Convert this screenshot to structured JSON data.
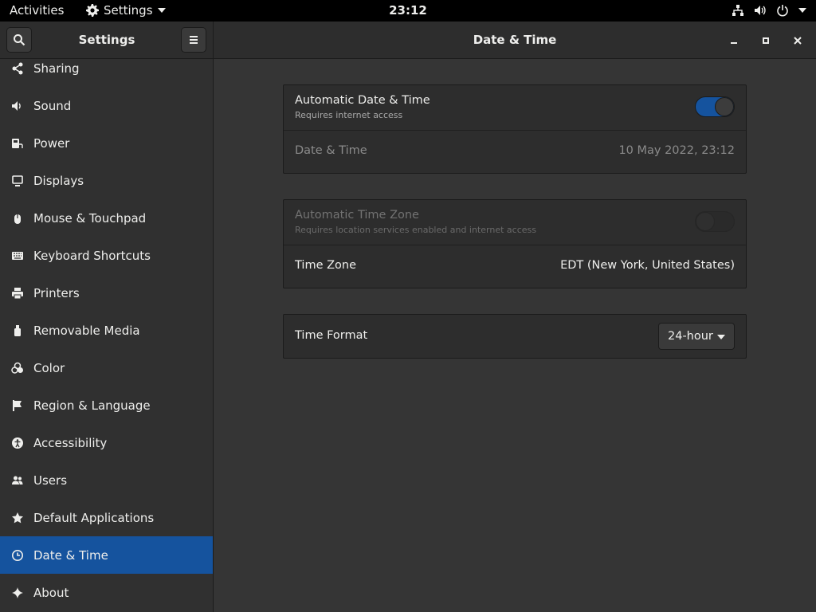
{
  "topbar": {
    "activities": "Activities",
    "app_menu": "Settings",
    "clock": "23:12"
  },
  "headerbar": {
    "sidebar_title": "Settings",
    "main_title": "Date & Time"
  },
  "sidebar": {
    "items": [
      {
        "label": "Sharing",
        "icon": "share-icon"
      },
      {
        "label": "Sound",
        "icon": "speaker-icon"
      },
      {
        "label": "Power",
        "icon": "power-plug-icon"
      },
      {
        "label": "Displays",
        "icon": "display-icon"
      },
      {
        "label": "Mouse & Touchpad",
        "icon": "mouse-icon"
      },
      {
        "label": "Keyboard Shortcuts",
        "icon": "keyboard-icon"
      },
      {
        "label": "Printers",
        "icon": "printer-icon"
      },
      {
        "label": "Removable Media",
        "icon": "usb-drive-icon"
      },
      {
        "label": "Color",
        "icon": "color-icon"
      },
      {
        "label": "Region & Language",
        "icon": "flag-icon"
      },
      {
        "label": "Accessibility",
        "icon": "accessibility-icon"
      },
      {
        "label": "Users",
        "icon": "users-icon"
      },
      {
        "label": "Default Applications",
        "icon": "star-icon"
      },
      {
        "label": "Date & Time",
        "icon": "clock-icon",
        "active": true
      },
      {
        "label": "About",
        "icon": "sparkle-icon"
      }
    ]
  },
  "main": {
    "auto_datetime": {
      "title": "Automatic Date & Time",
      "subtitle": "Requires internet access",
      "enabled": true
    },
    "datetime": {
      "label": "Date & Time",
      "value": "10 May 2022, 23:12"
    },
    "auto_timezone": {
      "title": "Automatic Time Zone",
      "subtitle": "Requires location services enabled and internet access",
      "enabled": false
    },
    "timezone": {
      "label": "Time Zone",
      "value": "EDT (New York, United States)"
    },
    "time_format": {
      "label": "Time Format",
      "value": "24-hour"
    }
  },
  "colors": {
    "accent": "#15539e",
    "background": "#353535",
    "sidebar": "#303030"
  }
}
